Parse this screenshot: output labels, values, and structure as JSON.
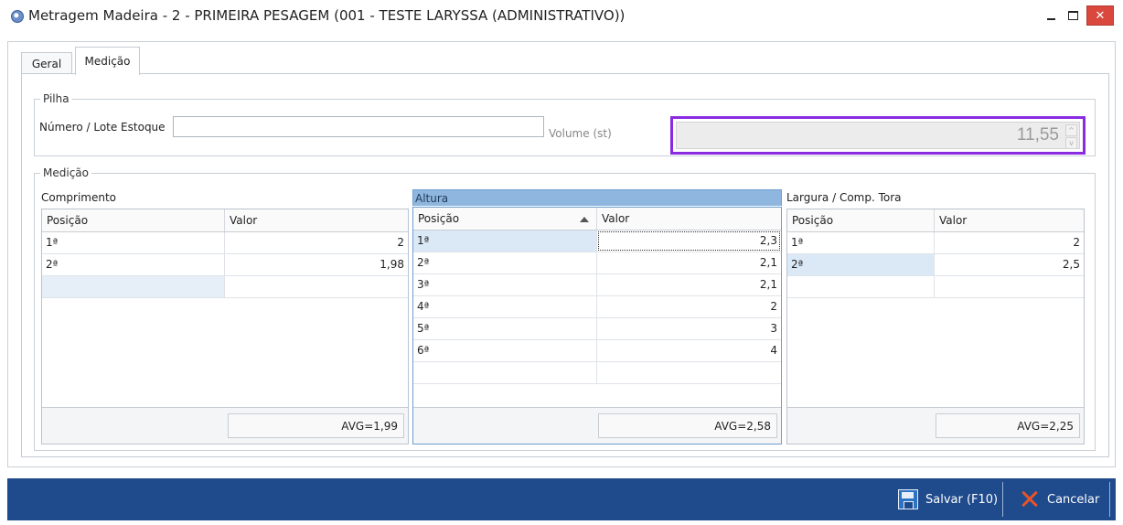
{
  "window": {
    "title": "Metragem Madeira - 2 - PRIMEIRA  PESAGEM (001 - TESTE LARYSSA (ADMINISTRATIVO))",
    "close_glyph": "✕"
  },
  "tabs": [
    {
      "label": "Geral"
    },
    {
      "label": "Medição"
    }
  ],
  "pilha": {
    "legend": "Pilha",
    "lote_label": "Número / Lote Estoque",
    "lote_value": "",
    "volume_label": "Volume (st)",
    "volume_value": "11,55",
    "spin_up": "^",
    "spin_down": "v"
  },
  "medicao": {
    "legend": "Medição",
    "grids": [
      {
        "caption": "Comprimento",
        "headers": [
          "Posição",
          "Valor"
        ],
        "rows": [
          [
            "1ª",
            "2"
          ],
          [
            "2ª",
            "1,98"
          ],
          [
            "",
            ""
          ]
        ],
        "avg": "AVG=1,99"
      },
      {
        "caption": "Altura",
        "headers": [
          "Posição",
          "Valor"
        ],
        "rows": [
          [
            "1ª",
            "2,3"
          ],
          [
            "2ª",
            "2,1"
          ],
          [
            "3ª",
            "2,1"
          ],
          [
            "4ª",
            "2"
          ],
          [
            "5ª",
            "3"
          ],
          [
            "6ª",
            "4"
          ],
          [
            "",
            ""
          ]
        ],
        "avg": "AVG=2,58"
      },
      {
        "caption": "Largura / Comp. Tora",
        "headers": [
          "Posição",
          "Valor"
        ],
        "rows": [
          [
            "1ª",
            "2"
          ],
          [
            "2ª",
            "2,5"
          ],
          [
            "",
            ""
          ]
        ],
        "avg": "AVG=2,25"
      }
    ]
  },
  "actions": {
    "save_label": "Salvar (F10)",
    "cancel_label": "Cancelar"
  },
  "colors": {
    "accent_highlight": "#8a2be2",
    "bottom_bar": "#1f4a8c",
    "selection": "#dbe9f7",
    "close_button": "#d9473d"
  }
}
